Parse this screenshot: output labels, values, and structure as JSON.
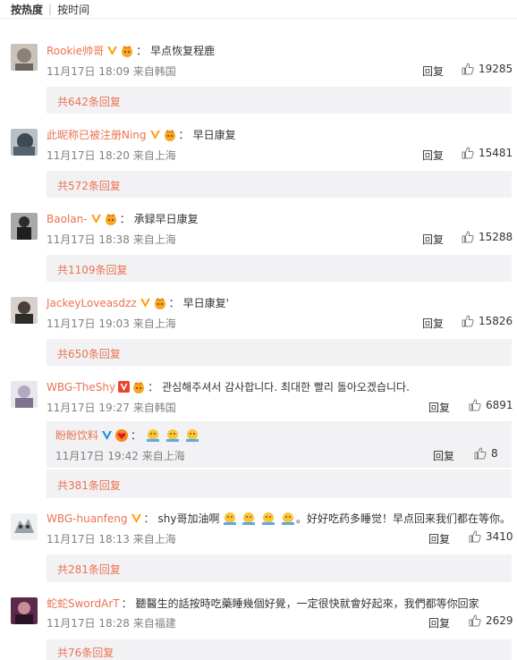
{
  "sort": {
    "hot": "按热度",
    "time": "按时间",
    "sep": "|"
  },
  "labels": {
    "reply": "回复"
  },
  "comments": [
    {
      "user": "Rookie帅哥",
      "text": "早点恢复程鹿",
      "time": "11月17日 18:09 来自韩国",
      "likes": "19285",
      "replies": "共642条回复"
    },
    {
      "user": "此昵称已被注册Ning",
      "text": "早日康复",
      "time": "11月17日 18:20 来自上海",
      "likes": "15481",
      "replies": "共572条回复"
    },
    {
      "user": "Baolan-",
      "text": "承録早日康复",
      "time": "11月17日 18:38 来自上海",
      "likes": "15288",
      "replies": "共1109条回复"
    },
    {
      "user": "JackeyLoveasdzz",
      "text": "早日康复'",
      "time": "11月17日 19:03 来自上海",
      "likes": "15826",
      "replies": "共650条回复"
    },
    {
      "user": "WBG-TheShy",
      "text": "관심해주셔서 감사합니다. 최대한 빨리 돌아오겠습니다.",
      "time": "11月17日 19:27 来自韩国",
      "likes": "6891",
      "replies": "共381条回复",
      "sub": {
        "user": "盼盼饮料",
        "time": "11月17日 19:42 来自上海",
        "likes": "8"
      }
    },
    {
      "user": "WBG-huanfeng",
      "text_a": "shy哥加油啊",
      "text_b": "。好好吃药多睡觉！早点回来我们都在等你。",
      "time": "11月17日 18:13 来自上海",
      "likes": "3410",
      "replies": "共281条回复"
    },
    {
      "user": "蛇蛇SwordArT",
      "text": "聽醫生的話按時吃藥睡幾個好覺，一定很快就會好起來，我們都等你回家",
      "time": "11月17日 18:28 来自福建",
      "likes": "2629",
      "replies": "共76条回复"
    }
  ],
  "colors": {
    "username": "#eb7350",
    "reply_bg": "#f2f2f5",
    "meta": "#808080",
    "vip": "#ffa00a"
  }
}
